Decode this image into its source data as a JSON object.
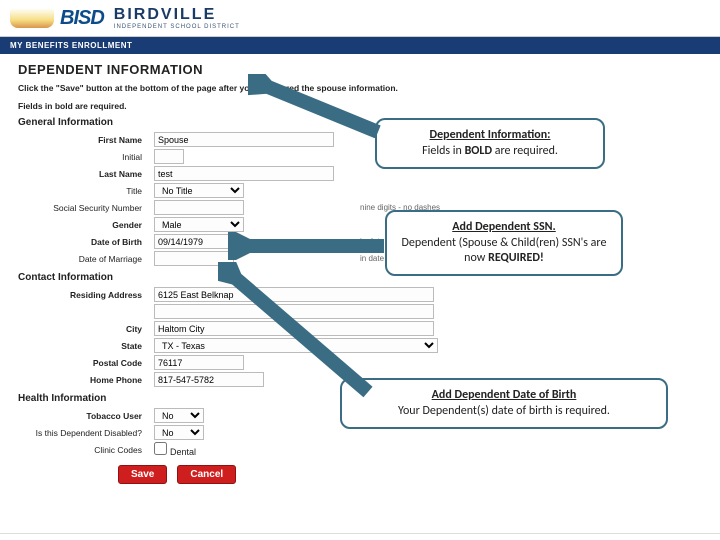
{
  "header": {
    "logo_initials": "BISD",
    "brand_main": "BIRDVILLE",
    "brand_sub": "INDEPENDENT SCHOOL DISTRICT"
  },
  "navbar": {
    "text": "MY BENEFITS ENROLLMENT"
  },
  "page": {
    "title": "DEPENDENT INFORMATION",
    "instruct": "Click the \"Save\" button at the bottom of the page after you've entered the spouse information.",
    "required": "Fields in bold are required."
  },
  "sections": {
    "general": "General Information",
    "contact": "Contact Information",
    "health": "Health Information"
  },
  "labels": {
    "first_name": "First Name",
    "initial": "Initial",
    "last_name": "Last Name",
    "title": "Title",
    "ssn": "Social Security Number",
    "gender": "Gender",
    "dob": "Date of Birth",
    "dom": "Date of Marriage",
    "address": "Residing Address",
    "city": "City",
    "state": "State",
    "postal": "Postal Code",
    "home_phone": "Home Phone",
    "tobacco": "Tobacco User",
    "disabled": "Is this Dependent Disabled?",
    "clinic": "Clinic Codes"
  },
  "values": {
    "first_name": "Spouse",
    "initial": "",
    "last_name": "test",
    "title": "No Title",
    "ssn": "",
    "gender": "Male",
    "dob": "09/14/1979",
    "dom": "",
    "address": "6125 East Belknap",
    "city": "Haltom City",
    "state": "TX - Texas",
    "postal": "76117",
    "home_phone": "817-547-5782",
    "tobacco": "No",
    "disabled": "No"
  },
  "hints": {
    "ssn": "nine digits - no dashes",
    "dob": "in date format: mm/dd/yyyy",
    "dom": "in date format: mm/dd/yyyy"
  },
  "clinic": {
    "dental": "Dental"
  },
  "buttons": {
    "save": "Save",
    "cancel": "Cancel"
  },
  "callouts": {
    "c1": {
      "head": "Dependent Information:",
      "body": "Fields in <strong>BOLD</strong> are required."
    },
    "c2": {
      "head": "Add Dependent SSN.",
      "body": "Dependent  (Spouse & Child(ren) SSN's are now <strong>REQUIRED!</strong>"
    },
    "c3": {
      "head": "Add Dependent Date of Birth",
      "body": "Your Dependent(s) date of birth is required."
    }
  }
}
